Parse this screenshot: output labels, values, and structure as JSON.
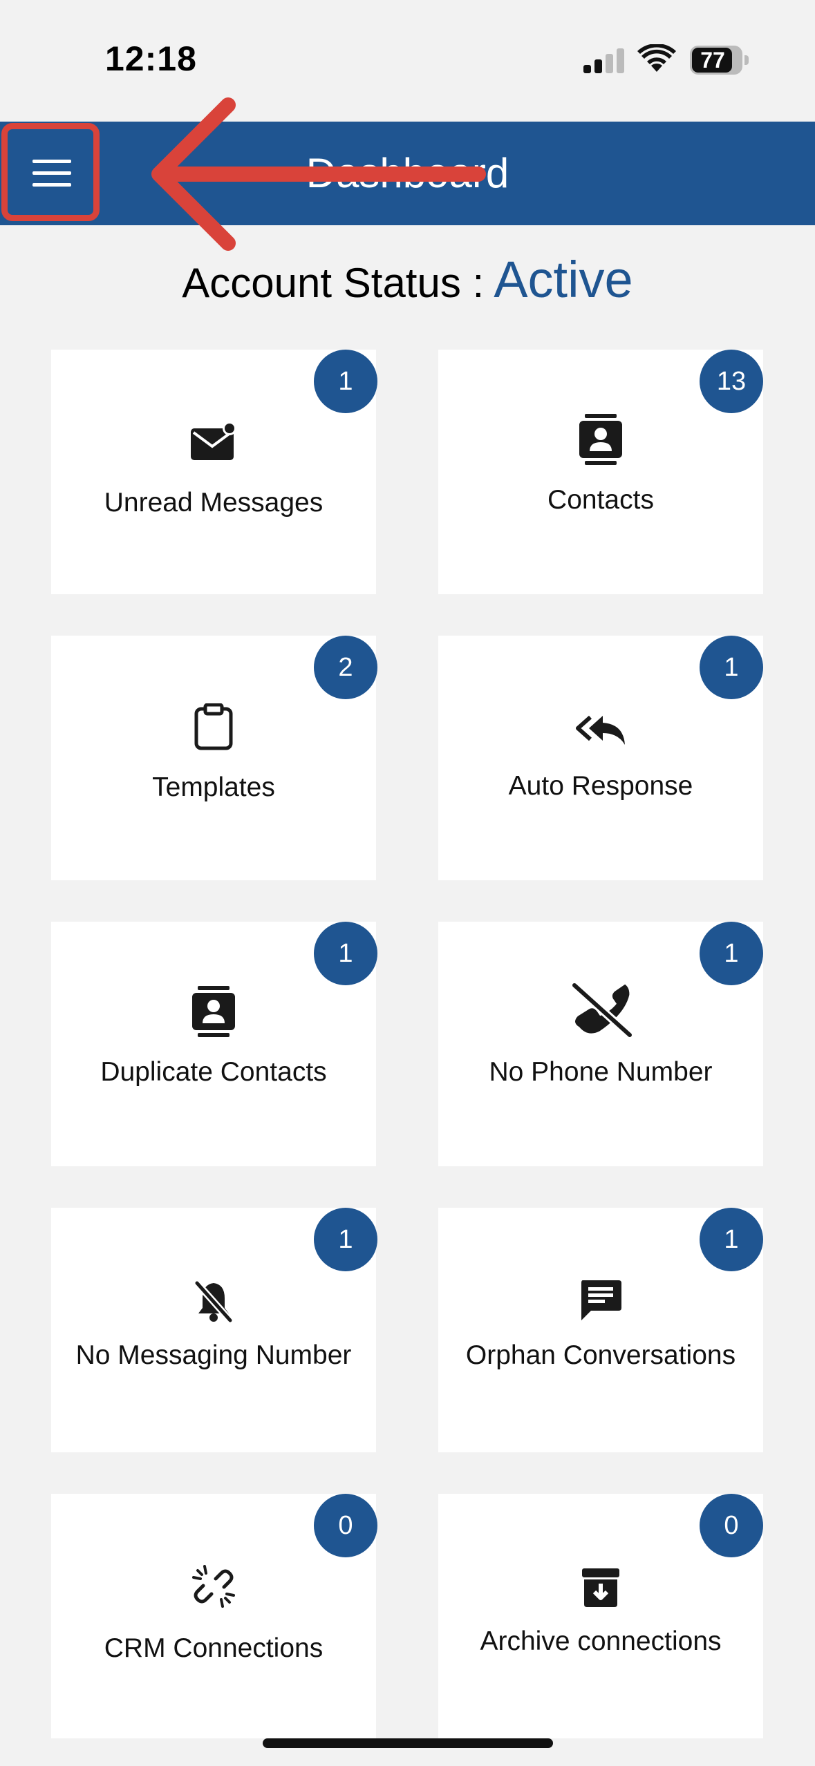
{
  "status_bar": {
    "time": "12:18",
    "battery": "77"
  },
  "header": {
    "title": "Dashboard",
    "menu_icon": "hamburger-menu-icon",
    "background_color": "#1f5591"
  },
  "annotation": {
    "color": "#d9433a"
  },
  "account_status": {
    "label": "Account Status :",
    "value": "Active"
  },
  "cards": [
    {
      "label": "Unread Messages",
      "count": "1",
      "icon": "mail-notification-icon"
    },
    {
      "label": "Contacts",
      "count": "13",
      "icon": "contact-card-icon"
    },
    {
      "label": "Templates",
      "count": "2",
      "icon": "clipboard-icon"
    },
    {
      "label": "Auto Response",
      "count": "1",
      "icon": "reply-all-icon"
    },
    {
      "label": "Duplicate Contacts",
      "count": "1",
      "icon": "contact-card-icon"
    },
    {
      "label": "No Phone Number",
      "count": "1",
      "icon": "phone-off-icon"
    },
    {
      "label": "No Messaging Number",
      "count": "1",
      "icon": "bell-off-icon"
    },
    {
      "label": "Orphan Conversations",
      "count": "1",
      "icon": "chat-message-icon"
    },
    {
      "label": "CRM Connections",
      "count": "0",
      "icon": "broken-link-icon"
    },
    {
      "label": "Archive connections",
      "count": "0",
      "icon": "archive-box-icon"
    }
  ]
}
